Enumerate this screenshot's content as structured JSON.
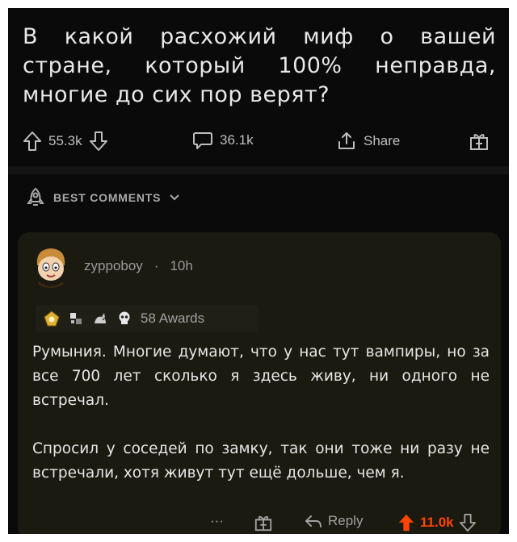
{
  "post": {
    "title_lines": [
      "В какой расхожий миф о вашей",
      "стране, который 100% неправда,",
      "многие до сих пор верят?"
    ],
    "upvotes": "55.3k",
    "comments": "36.1k",
    "share_label": "Share"
  },
  "sort": {
    "label": "BEST COMMENTS"
  },
  "comment": {
    "username": "zyppoboy",
    "separator": "·",
    "age": "10h",
    "awards_label": "58 Awards",
    "paragraphs": [
      "Румыния. Многие думают, что у нас тут вампиры, но за все 700 лет сколько я здесь живу, ни одного не встречал.",
      "Спросил у соседей по замку, так они тоже ни разу не встречали, хотя живут тут ещё дольше, чем я."
    ],
    "more_label": "···",
    "reply_label": "Reply",
    "score": "11.0k"
  },
  "colors": {
    "background": "#0a0a0a",
    "card": "#1a1a10",
    "upvote_active": "#ff4500",
    "text": "#e6e6e6",
    "muted": "#a0a0a0"
  }
}
